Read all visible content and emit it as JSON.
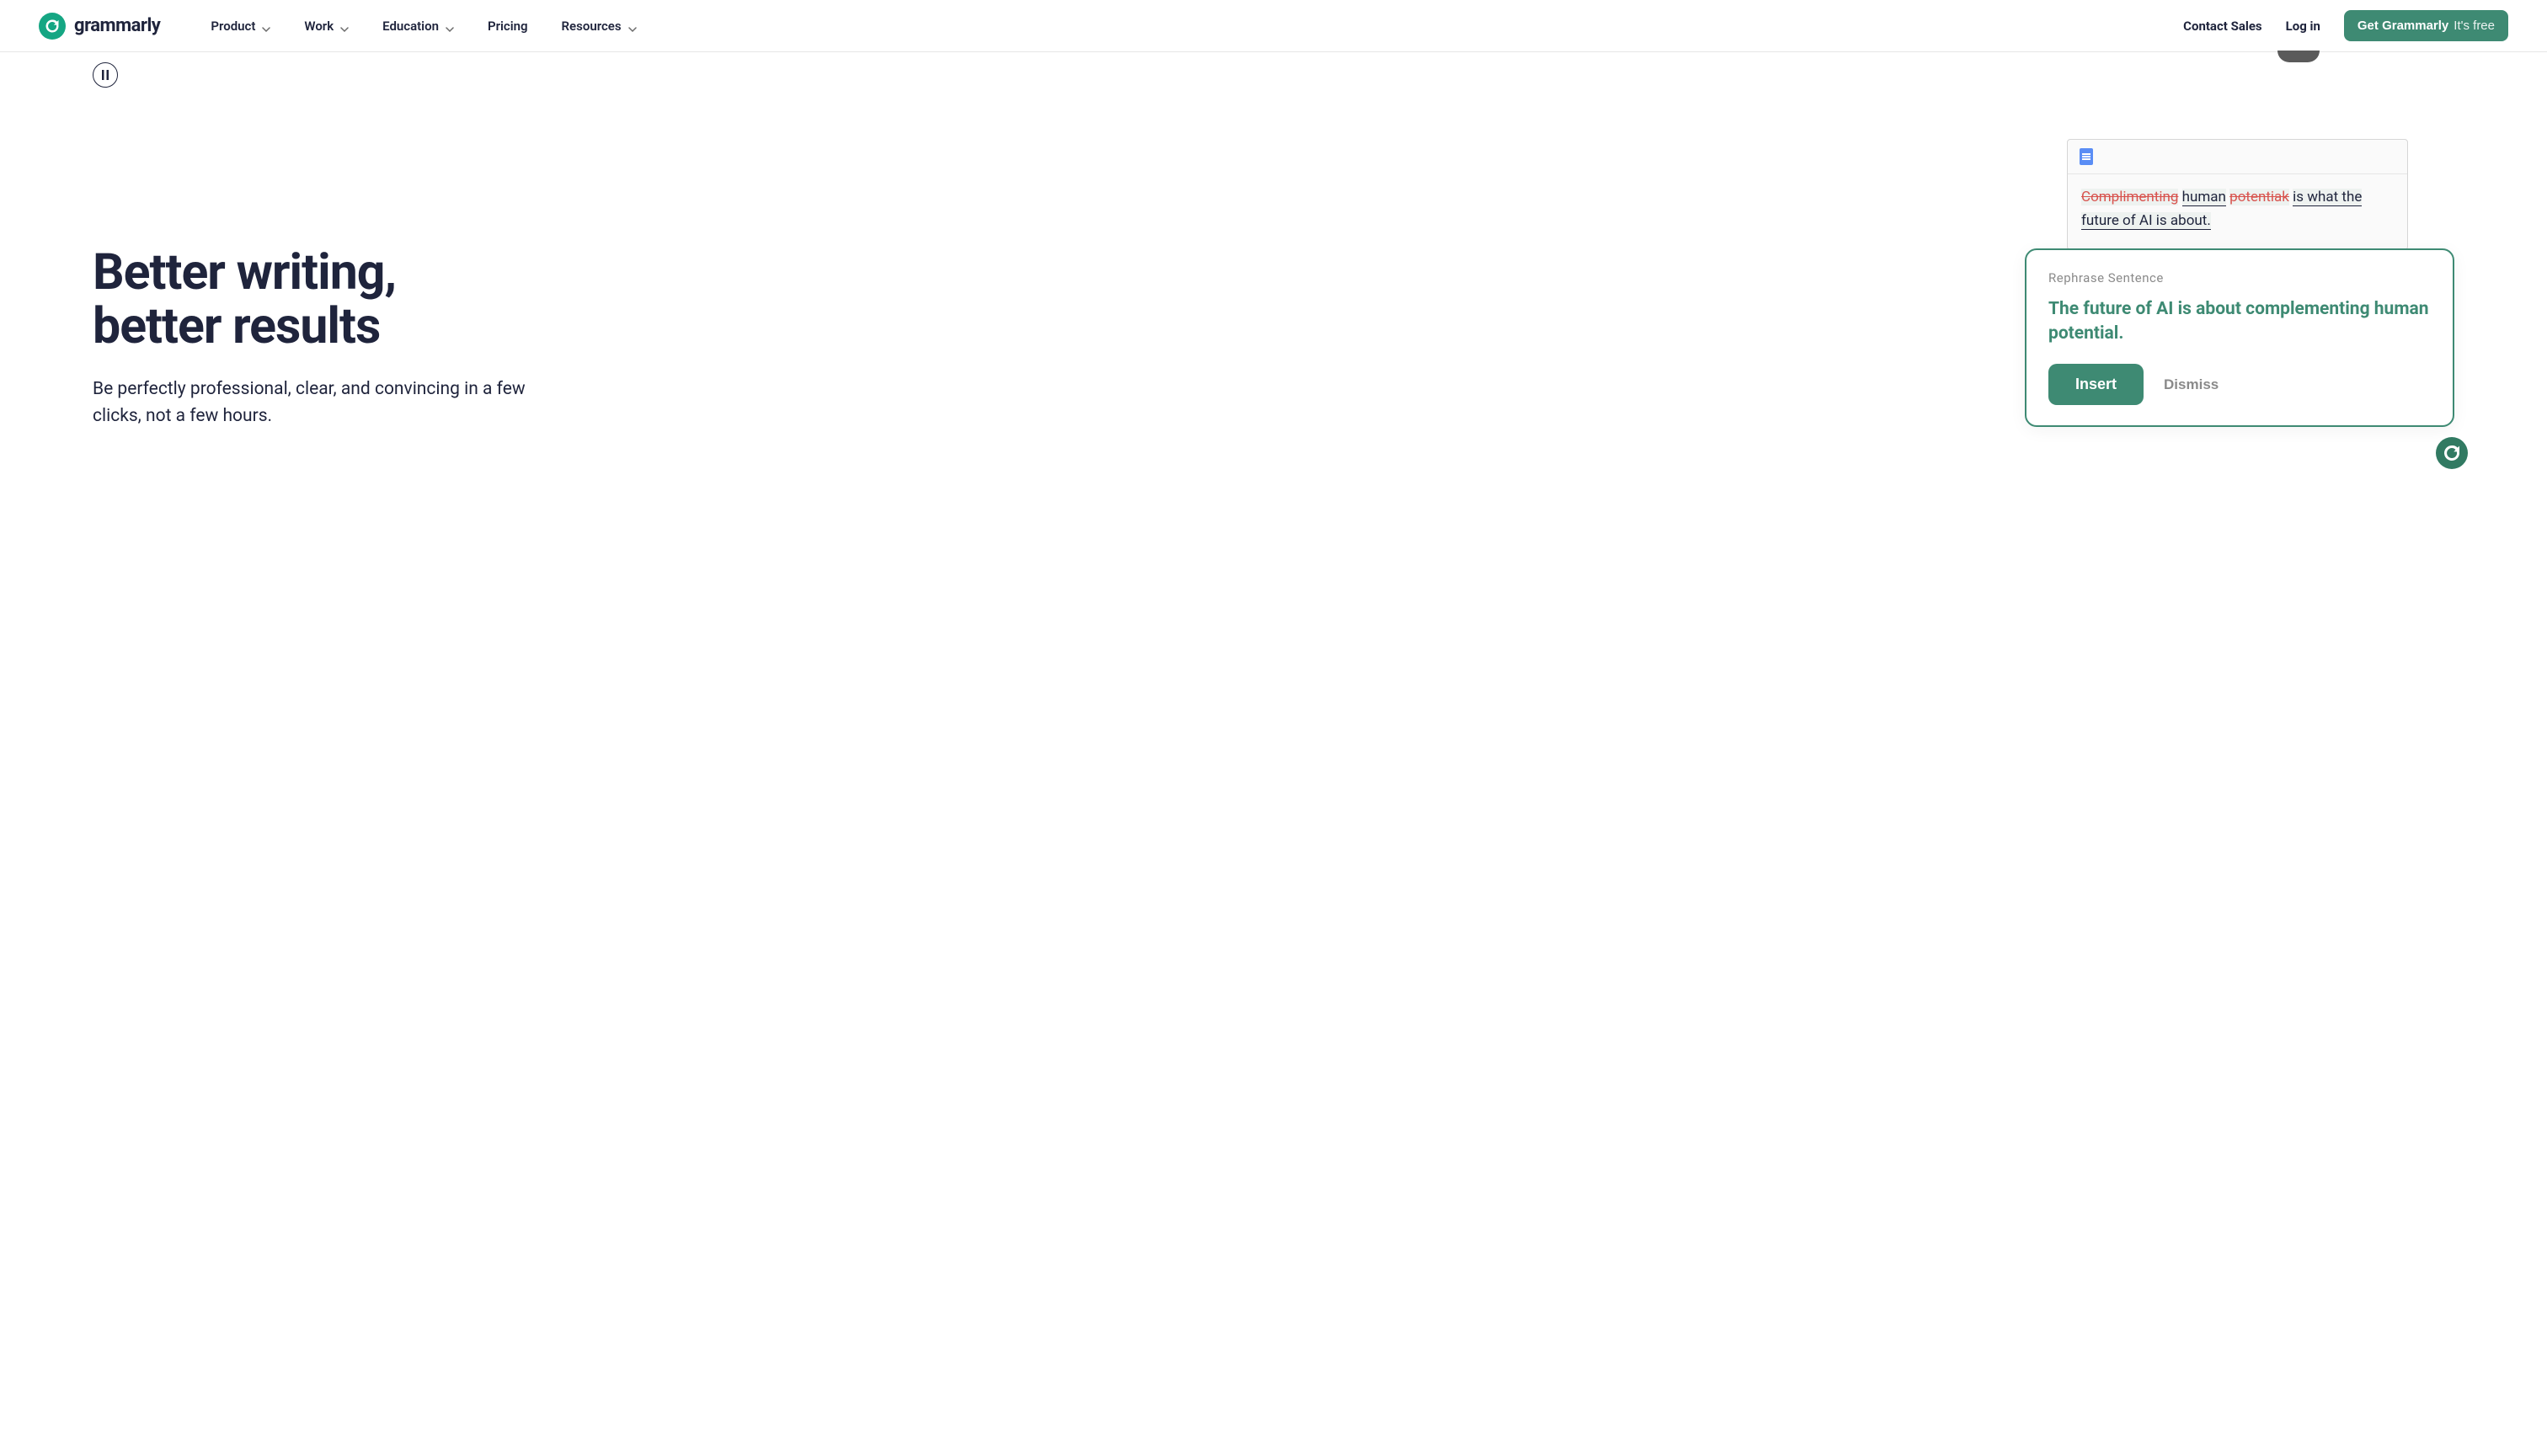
{
  "nav": {
    "logo_text": "grammarly",
    "items": [
      {
        "label": "Product",
        "has_chevron": true
      },
      {
        "label": "Work",
        "has_chevron": true
      },
      {
        "label": "Education",
        "has_chevron": true
      },
      {
        "label": "Pricing",
        "has_chevron": false
      },
      {
        "label": "Resources",
        "has_chevron": true
      }
    ],
    "contact": "Contact Sales",
    "login": "Log in",
    "cta_main": "Get Grammarly",
    "cta_sub": "It's free"
  },
  "hero": {
    "title_line1": "Better writing,",
    "title_line2": "better results",
    "subtitle": "Be perfectly professional, clear, and convincing in a few clicks, not a few hours."
  },
  "demo": {
    "doc": {
      "strike1": "Complimenting",
      "word1": "human",
      "strike2": "potentiak",
      "rest": "is what the future of AI is about."
    },
    "suggestion": {
      "label": "Rephrase Sentence",
      "text": "The future of AI is about complementing human potential.",
      "insert": "Insert",
      "dismiss": "Dismiss"
    }
  }
}
